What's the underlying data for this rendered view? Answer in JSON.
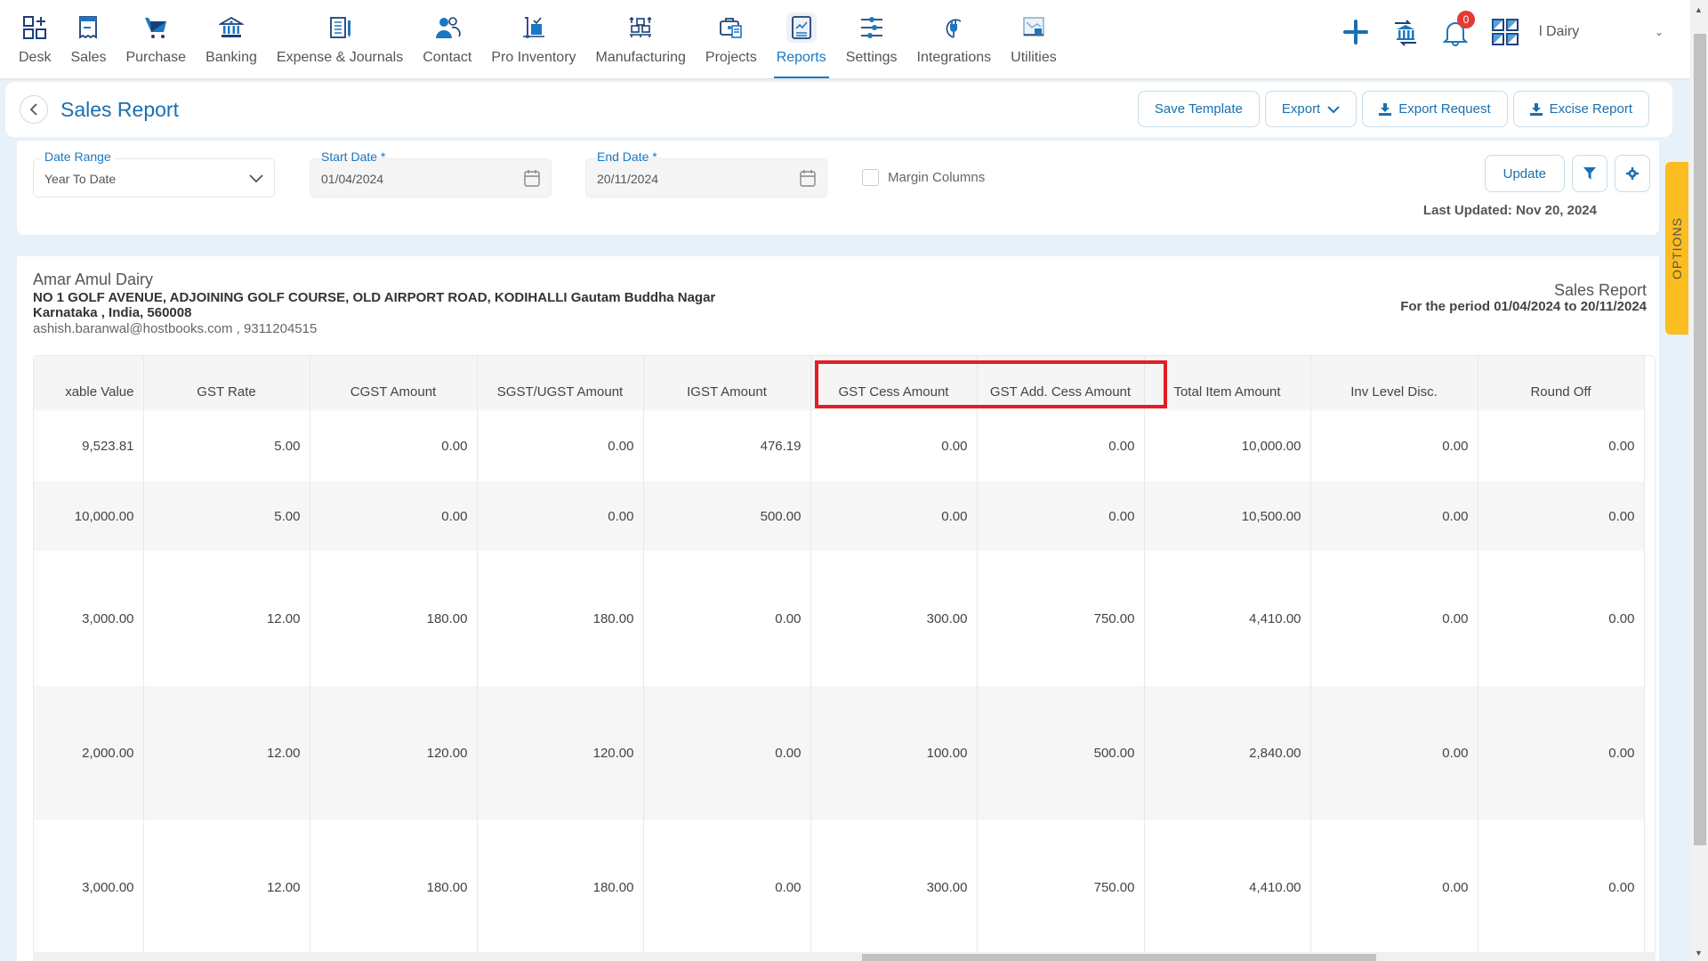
{
  "nav": {
    "items": [
      {
        "label": "Desk",
        "icon": "desk-icon"
      },
      {
        "label": "Sales",
        "icon": "sales-icon"
      },
      {
        "label": "Purchase",
        "icon": "purchase-cart-icon"
      },
      {
        "label": "Banking",
        "icon": "bank-icon"
      },
      {
        "label": "Expense & Journals",
        "icon": "journal-icon"
      },
      {
        "label": "Contact",
        "icon": "contact-icon"
      },
      {
        "label": "Pro Inventory",
        "icon": "inventory-icon"
      },
      {
        "label": "Manufacturing",
        "icon": "manufacturing-icon"
      },
      {
        "label": "Projects",
        "icon": "projects-icon"
      },
      {
        "label": "Reports",
        "icon": "reports-icon",
        "active": true
      },
      {
        "label": "Settings",
        "icon": "settings-sliders-icon"
      },
      {
        "label": "Integrations",
        "icon": "integrations-plug-icon"
      },
      {
        "label": "Utilities",
        "icon": "utilities-icon"
      }
    ],
    "notification_count": "0",
    "company": "l Dairy"
  },
  "header": {
    "title": "Sales Report",
    "buttons": {
      "save_template": "Save Template",
      "export": "Export",
      "export_request": "Export Request",
      "excise_report": "Excise Report"
    }
  },
  "filters": {
    "date_range": {
      "label": "Date Range",
      "value": "Year To Date"
    },
    "start_date": {
      "label": "Start Date *",
      "value": "01/04/2024"
    },
    "end_date": {
      "label": "End Date *",
      "value": "20/11/2024"
    },
    "margin_columns": {
      "label": "Margin Columns",
      "checked": false
    },
    "update_label": "Update",
    "last_updated": "Last Updated: Nov 20, 2024"
  },
  "options_tab": "OPTIONS",
  "report": {
    "company_name": "Amar Amul Dairy",
    "address_line1": "NO 1 GOLF AVENUE, ADJOINING GOLF COURSE, OLD AIRPORT ROAD, KODIHALLI Gautam Buddha Nagar",
    "address_line2": "Karnataka , India, 560008",
    "contact": "ashish.baranwal@hostbooks.com , 9311204515",
    "title": "Sales Report",
    "period": "For the period 01/04/2024 to 20/11/2024"
  },
  "table": {
    "columns": [
      "xable Value",
      "GST Rate",
      "CGST Amount",
      "SGST/UGST Amount",
      "IGST Amount",
      "GST Cess Amount",
      "GST Add. Cess Amount",
      "Total Item Amount",
      "Inv Level Disc.",
      "Round Off"
    ],
    "rows": [
      [
        "9,523.81",
        "5.00",
        "0.00",
        "0.00",
        "476.19",
        "0.00",
        "0.00",
        "10,000.00",
        "0.00",
        "0.00"
      ],
      [
        "10,000.00",
        "5.00",
        "0.00",
        "0.00",
        "500.00",
        "0.00",
        "0.00",
        "10,500.00",
        "0.00",
        "0.00"
      ],
      [
        "3,000.00",
        "12.00",
        "180.00",
        "180.00",
        "0.00",
        "300.00",
        "750.00",
        "4,410.00",
        "0.00",
        "0.00"
      ],
      [
        "2,000.00",
        "12.00",
        "120.00",
        "120.00",
        "0.00",
        "100.00",
        "500.00",
        "2,840.00",
        "0.00",
        "0.00"
      ],
      [
        "3,000.00",
        "12.00",
        "180.00",
        "180.00",
        "0.00",
        "300.00",
        "750.00",
        "4,410.00",
        "0.00",
        "0.00"
      ]
    ],
    "highlighted_columns": [
      "GST Cess Amount",
      "GST Add. Cess Amount"
    ],
    "highlight_color": "#e21e26"
  },
  "colors": {
    "primary": "#1a6fb0",
    "accent": "#1a78c2",
    "options_tab": "#fbbd1f",
    "badge": "#e53935"
  }
}
